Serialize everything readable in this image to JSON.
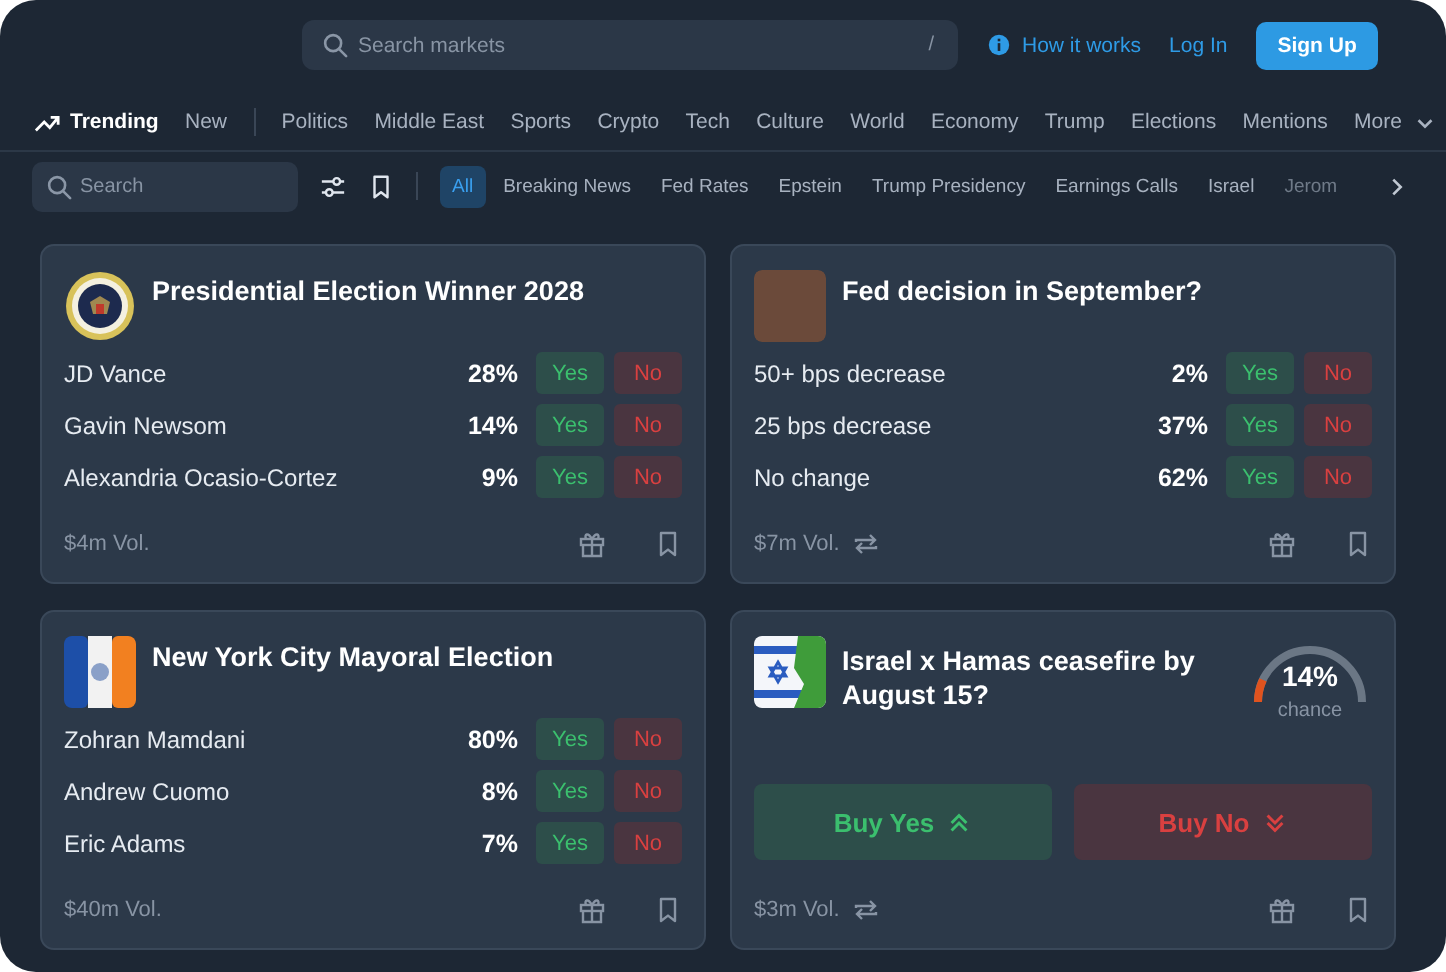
{
  "header": {
    "search": {
      "placeholder": "Search markets",
      "shortcut": "/"
    },
    "how_it_works": "How it works",
    "log_in": "Log In",
    "sign_up": "Sign Up"
  },
  "nav": {
    "primary": [
      {
        "label": "Trending",
        "selected": true
      },
      {
        "label": "New",
        "selected": false
      }
    ],
    "topics": [
      "Politics",
      "Middle East",
      "Sports",
      "Crypto",
      "Tech",
      "Culture",
      "World",
      "Economy",
      "Trump",
      "Elections",
      "Mentions"
    ],
    "more": "More"
  },
  "filters": {
    "search_placeholder": "Search",
    "chips": [
      {
        "label": "All",
        "selected": true
      },
      {
        "label": "Breaking News",
        "selected": false
      },
      {
        "label": "Fed Rates",
        "selected": false
      },
      {
        "label": "Epstein",
        "selected": false
      },
      {
        "label": "Trump Presidency",
        "selected": false
      },
      {
        "label": "Earnings Calls",
        "selected": false
      },
      {
        "label": "Israel",
        "selected": false
      },
      {
        "label": "Jerom",
        "selected": false
      }
    ]
  },
  "markets": [
    {
      "kind": "multi",
      "title": "Presidential Election Winner 2028",
      "outcomes": [
        {
          "name": "JD Vance",
          "chance": "28%",
          "yes": "Yes",
          "no": "No"
        },
        {
          "name": "Gavin Newsom",
          "chance": "14%",
          "yes": "Yes",
          "no": "No"
        },
        {
          "name": "Alexandria Ocasio-Cortez",
          "chance": "9%",
          "yes": "Yes",
          "no": "No"
        }
      ],
      "volume": "$4m Vol.",
      "recurring": false
    },
    {
      "kind": "multi",
      "title": "Fed decision in September?",
      "outcomes": [
        {
          "name": "50+ bps decrease",
          "chance": "2%",
          "yes": "Yes",
          "no": "No"
        },
        {
          "name": "25 bps decrease",
          "chance": "37%",
          "yes": "Yes",
          "no": "No"
        },
        {
          "name": "No change",
          "chance": "62%",
          "yes": "Yes",
          "no": "No"
        }
      ],
      "volume": "$7m Vol.",
      "recurring": true
    },
    {
      "kind": "multi",
      "title": "New York City Mayoral Election",
      "outcomes": [
        {
          "name": "Zohran Mamdani",
          "chance": "80%",
          "yes": "Yes",
          "no": "No"
        },
        {
          "name": "Andrew Cuomo",
          "chance": "8%",
          "yes": "Yes",
          "no": "No"
        },
        {
          "name": "Eric Adams",
          "chance": "7%",
          "yes": "Yes",
          "no": "No"
        }
      ],
      "volume": "$40m Vol.",
      "recurring": false
    },
    {
      "kind": "binary",
      "title": "Israel x Hamas ceasefire by August 15?",
      "chance": "14%",
      "chance_label": "chance",
      "level": 0.14,
      "buy_yes": "Buy Yes",
      "buy_no": "Buy No",
      "volume": "$3m Vol.",
      "recurring": true
    }
  ]
}
